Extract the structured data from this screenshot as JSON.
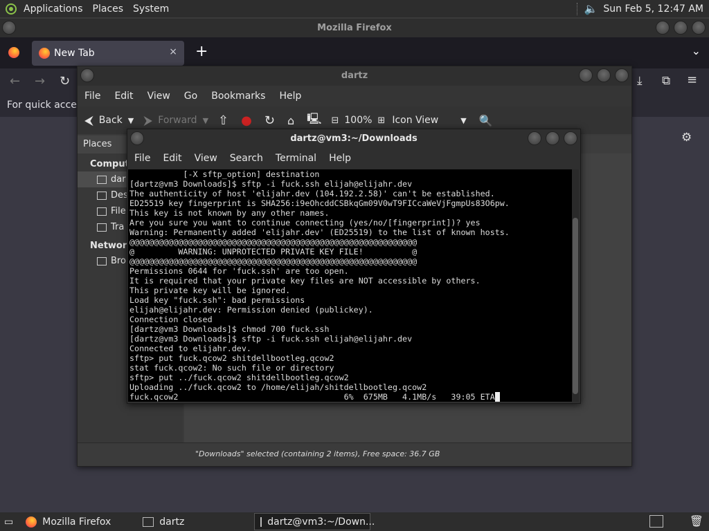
{
  "top_panel": {
    "menus": [
      "Applications",
      "Places",
      "System"
    ],
    "clock": "Sun Feb  5, 12:47 AM"
  },
  "firefox": {
    "window_title": "Mozilla Firefox",
    "tab_title": "New Tab",
    "tab_close": "×",
    "new_tab": "+",
    "bookmarks_hint": "For quick access,"
  },
  "file_manager": {
    "window_title": "dartz",
    "menu": [
      "File",
      "Edit",
      "View",
      "Go",
      "Bookmarks",
      "Help"
    ],
    "toolbar": {
      "back": "Back",
      "forward": "Forward",
      "zoom": "100%",
      "view_mode": "Icon View"
    },
    "sidebar_header": "Places",
    "sidebar": {
      "computer_label": "Comput",
      "computer_items": [
        "dar",
        "Des",
        "File",
        "Tra"
      ],
      "network_label": "Network",
      "network_items": [
        "Bro"
      ]
    },
    "status": "\"Downloads\" selected (containing 2 items), Free space: 36.7 GB"
  },
  "terminal": {
    "window_title": "dartz@vm3:~/Downloads",
    "menu": [
      "File",
      "Edit",
      "View",
      "Search",
      "Terminal",
      "Help"
    ],
    "lines": [
      "           [-X sftp_option] destination",
      "[dartz@vm3 Downloads]$ sftp -i fuck.ssh elijah@elijahr.dev",
      "The authenticity of host 'elijahr.dev (104.192.2.58)' can't be established.",
      "ED25519 key fingerprint is SHA256:i9eOhcddCSBkqGm09V0wT9FICcaWeVjFgmpUs83O6pw.",
      "This key is not known by any other names.",
      "Are you sure you want to continue connecting (yes/no/[fingerprint])? yes",
      "Warning: Permanently added 'elijahr.dev' (ED25519) to the list of known hosts.",
      "@@@@@@@@@@@@@@@@@@@@@@@@@@@@@@@@@@@@@@@@@@@@@@@@@@@@@@@@@@@",
      "@         WARNING: UNPROTECTED PRIVATE KEY FILE!          @",
      "@@@@@@@@@@@@@@@@@@@@@@@@@@@@@@@@@@@@@@@@@@@@@@@@@@@@@@@@@@@",
      "Permissions 0644 for 'fuck.ssh' are too open.",
      "It is required that your private key files are NOT accessible by others.",
      "This private key will be ignored.",
      "Load key \"fuck.ssh\": bad permissions",
      "elijah@elijahr.dev: Permission denied (publickey).",
      "Connection closed",
      "[dartz@vm3 Downloads]$ chmod 700 fuck.ssh",
      "[dartz@vm3 Downloads]$ sftp -i fuck.ssh elijah@elijahr.dev",
      "Connected to elijahr.dev.",
      "sftp> put fuck.qcow2 shitdellbootleg.qcow2",
      "stat fuck.qcow2: No such file or directory",
      "sftp> put ../fuck.qcow2 shitdellbootleg.qcow2",
      "Uploading ../fuck.qcow2 to /home/elijah/shitdellbootleg.qcow2"
    ],
    "last_line": "fuck.qcow2                                  6%  675MB   4.1MB/s   39:05 ETA"
  },
  "taskbar": {
    "items": [
      "Mozilla Firefox",
      "dartz",
      "dartz@vm3:~/Down..."
    ]
  },
  "colors": {
    "terminal_bg": "#000000",
    "terminal_fg": "#dcdcdc",
    "panel_bg": "#2d2d2d"
  }
}
